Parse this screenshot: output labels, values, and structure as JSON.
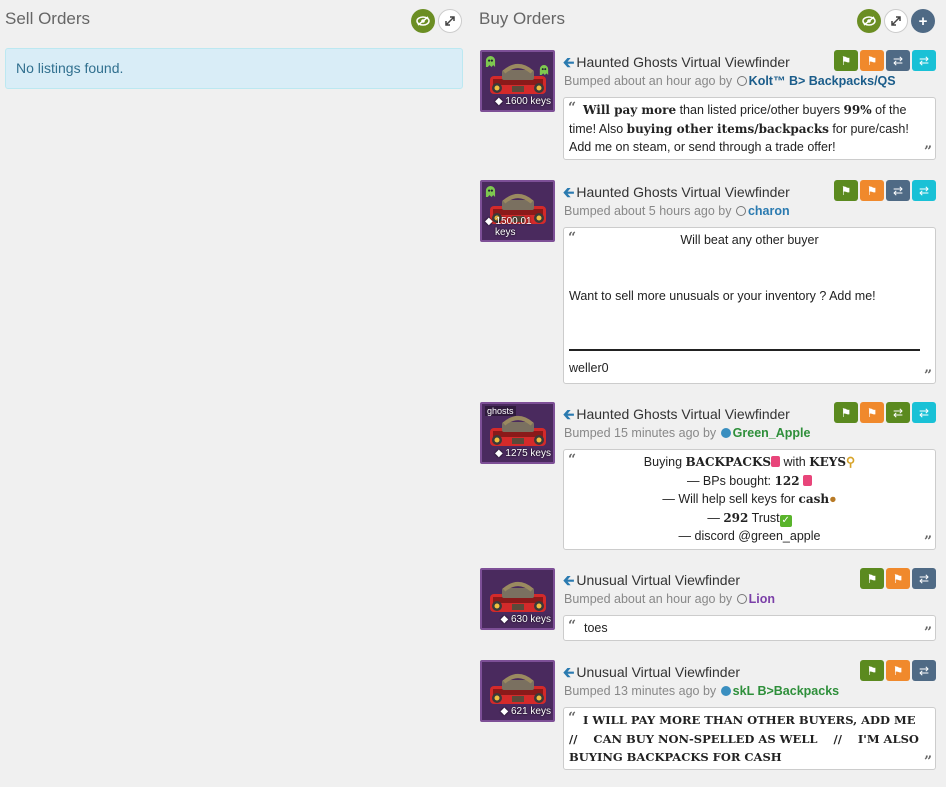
{
  "sell": {
    "title": "Sell Orders",
    "empty_text": "No listings found."
  },
  "buy": {
    "title": "Buy Orders"
  },
  "listings": [
    {
      "item_name": "Haunted Ghosts Virtual Viewfinder",
      "price": "1600 keys",
      "bumped": "Bumped about an hour ago by",
      "user": "Kolt™ B> Backpacks/QS",
      "user_color": "#1a5c8a",
      "quote_parts": {
        "a1": "Will pay more",
        "a2": " than listed price/other buyers ",
        "a3": "99%",
        "a4": " of the time! Also ",
        "a5": "buying other items/backpacks",
        "a6": " for pure/cash! Add me on steam, or send through a trade offer!"
      }
    },
    {
      "item_name": "Haunted Ghosts Virtual Viewfinder",
      "price_line1": "1500.01",
      "price_line2": "keys",
      "bumped": "Bumped about 5 hours ago by",
      "user": "charon",
      "user_color": "#2a7ab0",
      "quote_lines": {
        "l1": "Will beat any other buyer",
        "l2": "Want to sell more unusuals or your inventory ? Add me!",
        "l3": "weller0"
      }
    },
    {
      "item_name": "Haunted Ghosts Virtual Viewfinder",
      "effect": "ghosts",
      "price": "1275 keys",
      "bumped": "Bumped 15 minutes ago by",
      "user": "Green_Apple",
      "user_color": "#2e8f3a",
      "quote_lines": {
        "l1a": "Buying ",
        "l1b": "BACKPACKS",
        "l1c": " with ",
        "l1d": "KEYS",
        "l2a": "— BPs bought: ",
        "l2b": "122",
        "l3a": "— Will help sell keys for ",
        "l3b": "cash",
        "l4a": "— ",
        "l4b": "292",
        "l4c": " Trust",
        "l5": "— discord @green_apple"
      }
    },
    {
      "item_name": "Unusual Virtual Viewfinder",
      "price": "630 keys",
      "bumped": "Bumped about an hour ago by",
      "user": "Lion",
      "user_color": "#7b3fa8",
      "quote": "toes"
    },
    {
      "item_name": "Unusual Virtual Viewfinder",
      "price": "621 keys",
      "bumped": "Bumped 13 minutes ago by",
      "user": "skL B>Backpacks",
      "user_color": "#2e8f3a",
      "quote": "I WILL PAY MORE THAN OTHER BUYERS, ADD ME    //    CAN BUY NON-SPELLED AS WELL    //    I'M ALSO BUYING BACKPACKS FOR CASH"
    }
  ],
  "icons": {
    "back_arrow": "arrow-left-icon",
    "eye": "eye-slash-icon",
    "expand": "expand-icon",
    "plus": "plus-icon",
    "tag": "tag-icon",
    "flag": "flag-icon",
    "trade": "exchange-icon",
    "offer": "offer-icon"
  },
  "colors": {
    "accent_green": "#5b8a1f",
    "flag_orange": "#f0892c",
    "trade_slate": "#4f6a85",
    "offer_cyan": "#19c1d6",
    "unusual_purple": "#7d4f96"
  }
}
